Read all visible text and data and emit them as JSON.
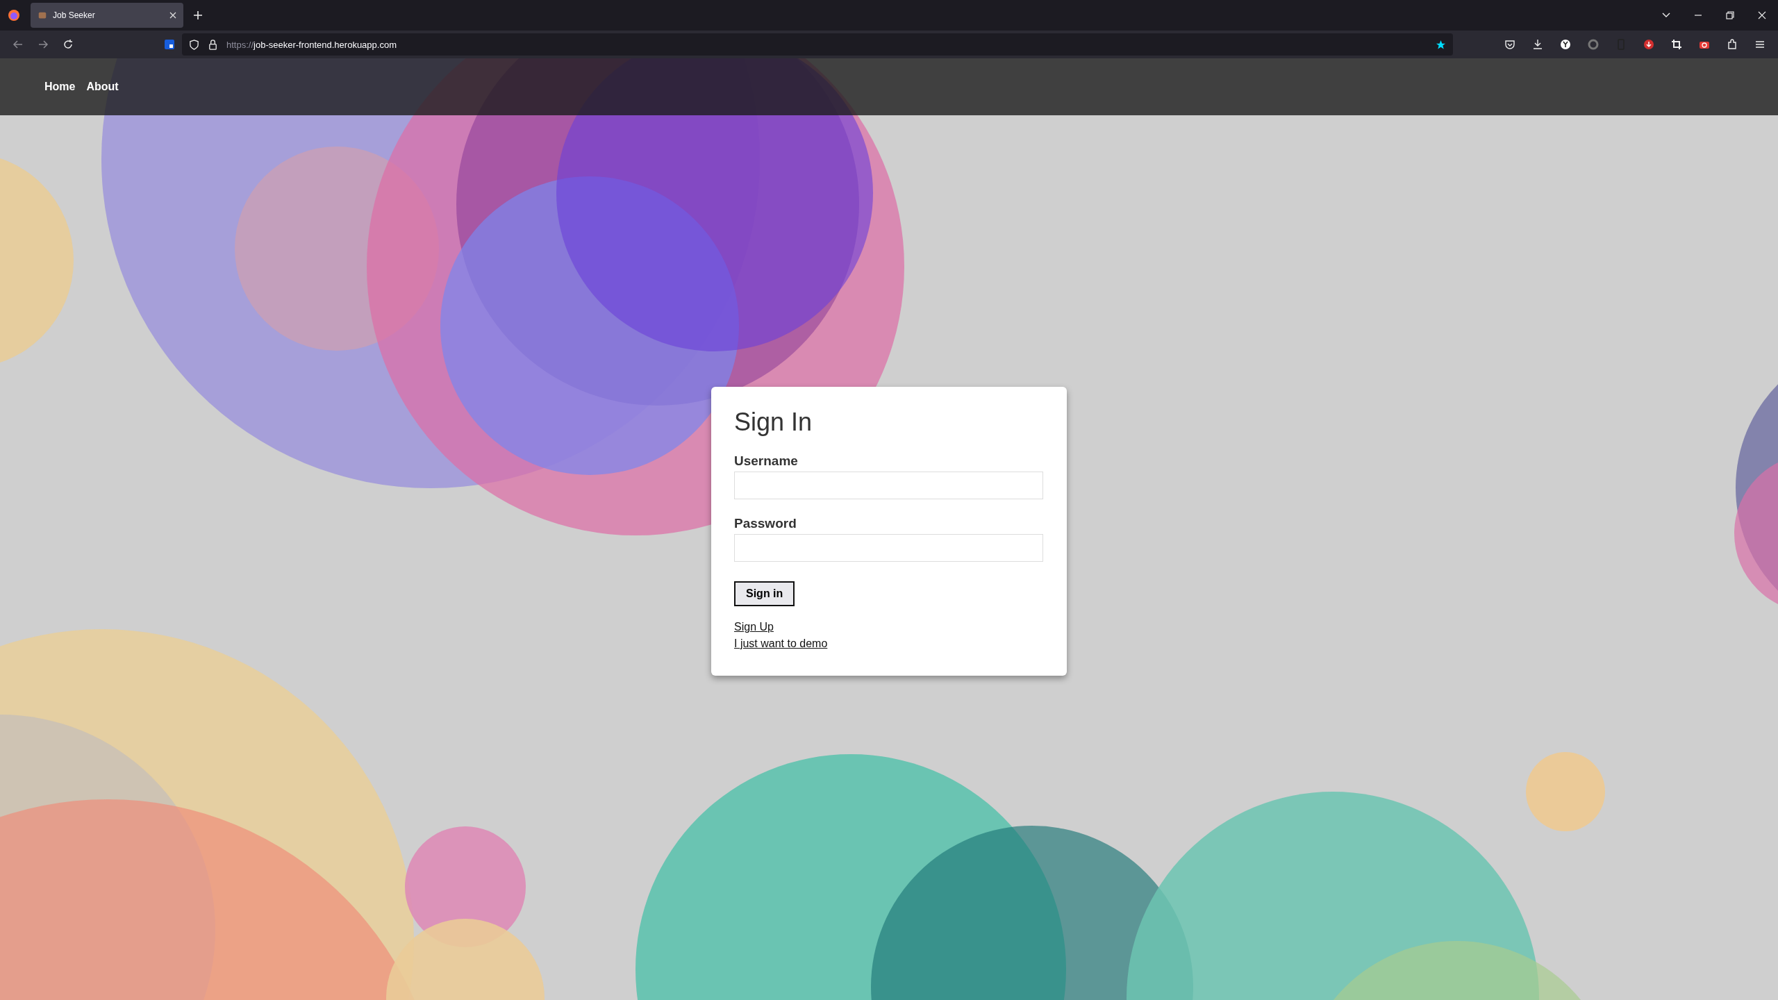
{
  "browser": {
    "tab_title": "Job Seeker",
    "url_scheme": "https://",
    "url_host": "job-seeker-frontend.herokuapp.com"
  },
  "nav": {
    "links": [
      "Home",
      "About"
    ]
  },
  "form": {
    "title": "Sign In",
    "fields": [
      {
        "label": "Username"
      },
      {
        "label": "Password"
      }
    ],
    "submit": "Sign in",
    "links": [
      "Sign Up",
      "I just want to demo"
    ]
  }
}
